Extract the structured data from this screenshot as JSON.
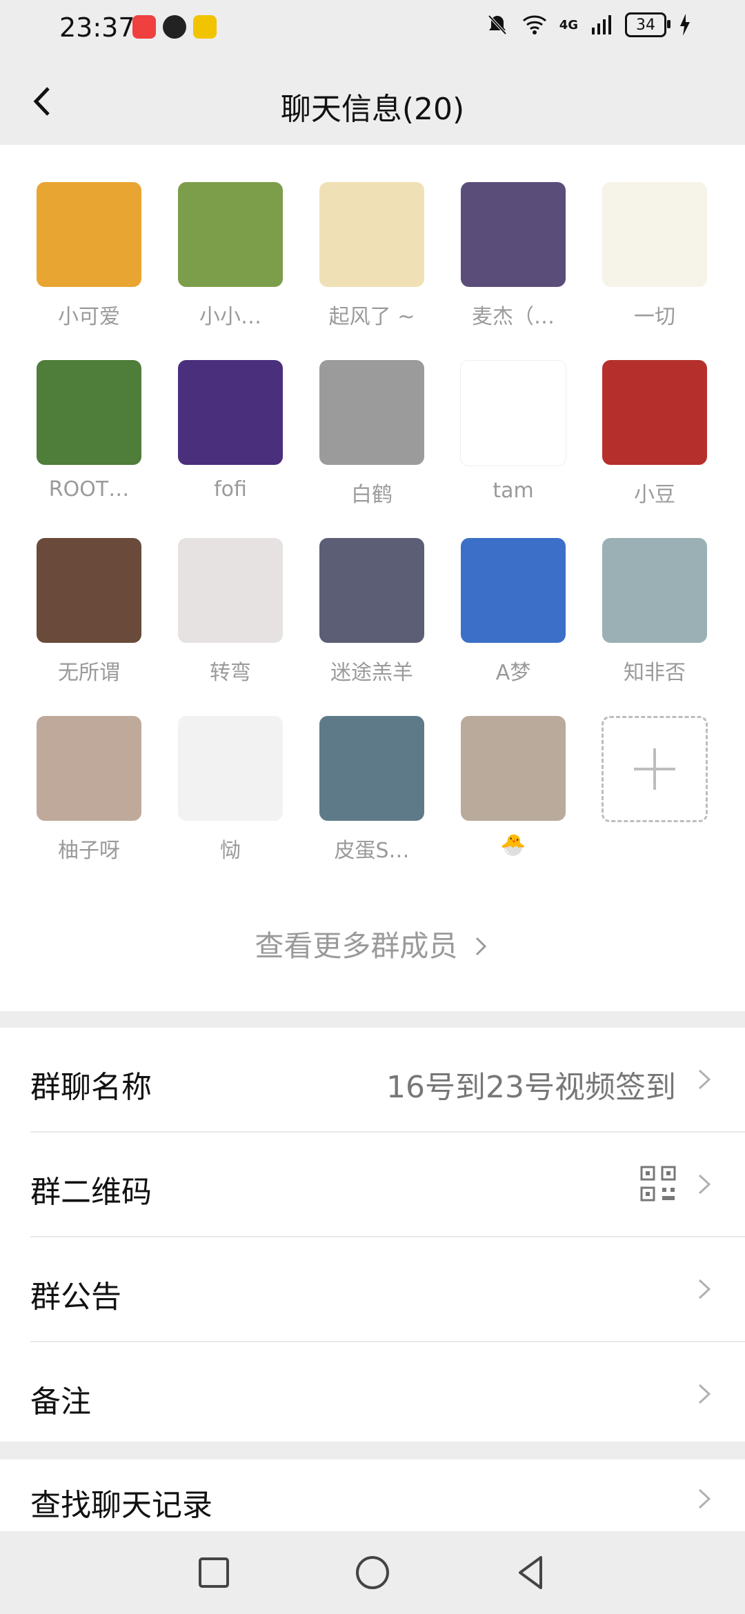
{
  "status": {
    "time": "23:37",
    "network": "4G",
    "battery": "34"
  },
  "header": {
    "title": "聊天信息(20)"
  },
  "members": [
    {
      "name": "小可爱",
      "color": "#e8a531"
    },
    {
      "name": "小小…",
      "color": "#7c9d4a"
    },
    {
      "name": "起风了 ~",
      "color": "#f0e0b5"
    },
    {
      "name": "麦杰（…",
      "color": "#5a4d7a"
    },
    {
      "name": "一切",
      "color": "#f6f3e8"
    },
    {
      "name": "ROOT…",
      "color": "#4f7d3a"
    },
    {
      "name": "fofi",
      "color": "#4a2f7c"
    },
    {
      "name": "白鹤",
      "color": "#9b9b9b"
    },
    {
      "name": "tam",
      "color": "#ffffff"
    },
    {
      "name": "小豆",
      "color": "#b5302c"
    },
    {
      "name": "无所谓",
      "color": "#6a4a3a"
    },
    {
      "name": "转弯",
      "color": "#e7e2e2"
    },
    {
      "name": "迷途羔羊",
      "color": "#5b5e75"
    },
    {
      "name": "A梦",
      "color": "#3c6fc7"
    },
    {
      "name": "知非否",
      "color": "#9ab0b5"
    },
    {
      "name": "柚子呀",
      "color": "#bfa99a"
    },
    {
      "name": "恸",
      "color": "#f2f2f2"
    },
    {
      "name": "皮蛋S…",
      "color": "#5e7a88"
    },
    {
      "name": "🐣",
      "color": "#b9aa9b"
    }
  ],
  "more_members_label": "查看更多群成员",
  "settings": {
    "group_name_label": "群聊名称",
    "group_name_value": "16号到23号视频签到",
    "qr_label": "群二维码",
    "notice_label": "群公告",
    "remark_label": "备注",
    "search_history_label": "查找聊天记录"
  }
}
